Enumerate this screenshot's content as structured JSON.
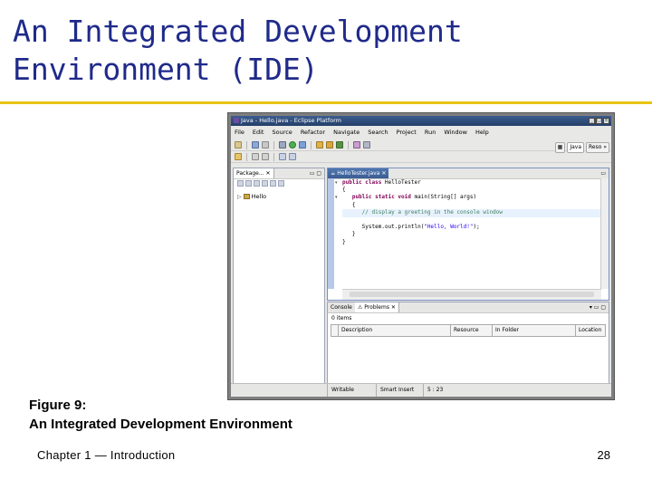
{
  "slide": {
    "title_line1": "An Integrated Development",
    "title_line2": "Environment (IDE)",
    "caption_line1": "Figure 9:",
    "caption_line2": "An Integrated Development Environment",
    "footer": "Chapter 1 — Introduction",
    "page_number": "28"
  },
  "ide": {
    "window_title": "Java - Hello.java - Eclipse Platform",
    "menu": [
      "File",
      "Edit",
      "Source",
      "Refactor",
      "Navigate",
      "Search",
      "Project",
      "Run",
      "Window",
      "Help"
    ],
    "perspectives": [
      "Java",
      "Reso"
    ],
    "package_view": {
      "tab_label": "Package...",
      "project": "Hello"
    },
    "editor": {
      "tab_label": "HelloTester.java",
      "code_lines": [
        "public class HelloTester",
        "{",
        "   public static void main(String[] args)",
        "   {",
        "      // display a greeting in the console window",
        "",
        "      System.out.println(\"Hello, World!\");",
        "   }",
        "}"
      ]
    },
    "bottom_views": {
      "tabs": [
        "Console",
        "Problems"
      ],
      "items_label": "0 items",
      "columns": [
        "Description",
        "Resource",
        "In Folder",
        "Location"
      ]
    },
    "status": {
      "writable": "Writable",
      "insert_mode": "Smart Insert",
      "position": "5 : 23"
    }
  },
  "colors": {
    "title_blue": "#1f2a8a",
    "title_rule": "#e7c413",
    "keyword": "#7f0055",
    "comment": "#3f7f5f",
    "string": "#2a00ff"
  }
}
